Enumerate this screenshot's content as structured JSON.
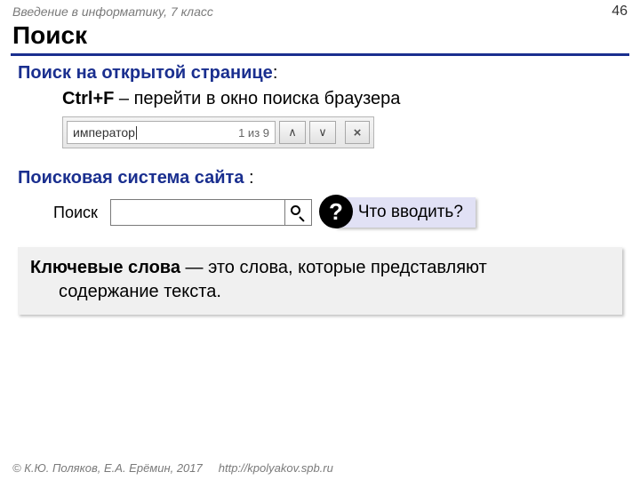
{
  "header": {
    "course": "Введение в информатику, 7 класс",
    "page": "46"
  },
  "title": "Поиск",
  "section1": {
    "heading": "Поиск на открытой странице",
    "colon": ":",
    "shortcut": "Ctrl+F",
    "shortcut_desc": " – перейти в окно поиска браузера",
    "findbar": {
      "query": "император",
      "count": "1 из 9",
      "prev": "∧",
      "next": "∨",
      "close": "×"
    }
  },
  "section2": {
    "heading": "Поисковая система сайта ",
    "colon": ":",
    "search_label": "Поиск",
    "question": "Что вводить?",
    "question_badge": "?"
  },
  "definition": {
    "term": "Ключевые слова",
    "line1_rest": " — это слова, которые представляют",
    "line2": "содержание текста."
  },
  "footer": {
    "copyright": "© К.Ю. Поляков, Е.А. Ерёмин, 2017",
    "url": "http://kpolyakov.spb.ru"
  }
}
